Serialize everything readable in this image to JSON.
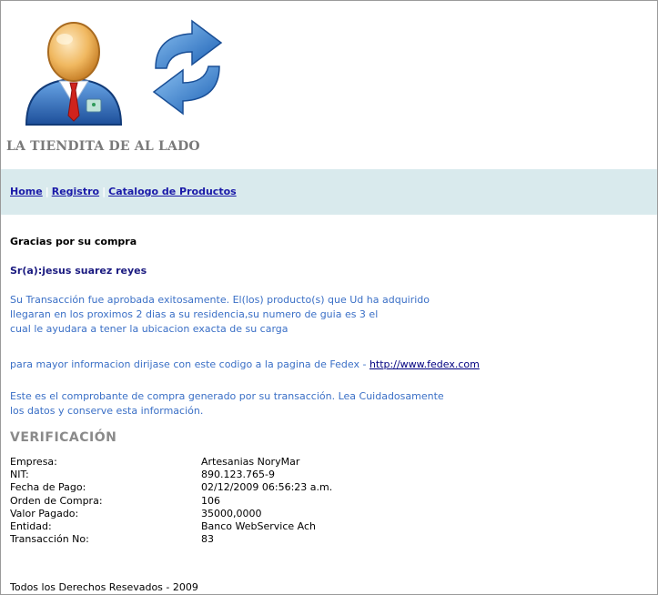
{
  "header": {
    "store_name": "LA TIENDITA DE AL LADO"
  },
  "nav": {
    "items": [
      "Home",
      "Registro",
      "Catalogo de Productos"
    ]
  },
  "content": {
    "thanks": "Gracias por su compra",
    "customer": "Sr(a):jesus suarez reyes",
    "transaction_lines": [
      "Su Transacción fue aprobada exitosamente. El(los) producto(s) que Ud ha adquirido",
      "llegaran en los proximos 2 dias a su residencia,su numero de guia es 3  el",
      "cual le ayudara a tener la ubicacion exacta de su carga"
    ],
    "fedex_text": "para mayor informacion dirijase con este codigo a la pagina de Fedex - ",
    "fedex_link": "http://www.fedex.com",
    "receipt_lines": [
      "Este es el comprobante de compra generado por su transacción. Lea Cuidadosamente",
      "los datos y conserve esta información."
    ]
  },
  "verification": {
    "title": "VERIFICACIÓN",
    "rows": [
      {
        "label": "Empresa:",
        "value": "Artesanias NoryMar"
      },
      {
        "label": "NIT:",
        "value": "890.123.765-9"
      },
      {
        "label": "Fecha de Pago:",
        "value": "02/12/2009 06:56:23 a.m."
      },
      {
        "label": "Orden de Compra:",
        "value": "106"
      },
      {
        "label": "Valor Pagado:",
        "value": "35000,0000"
      },
      {
        "label": "Entidad:",
        "value": "Banco WebService Ach"
      },
      {
        "label": "Transacción No:",
        "value": "83"
      }
    ]
  },
  "footer": {
    "text": "Todos los Derechos Resevados - 2009"
  },
  "icons": [
    "user-avatar-icon",
    "refresh-arrows-icon"
  ],
  "colors": {
    "nav_bg": "#d9eaed",
    "link": "#1a1aa8",
    "message_text": "#3a6fc6"
  }
}
